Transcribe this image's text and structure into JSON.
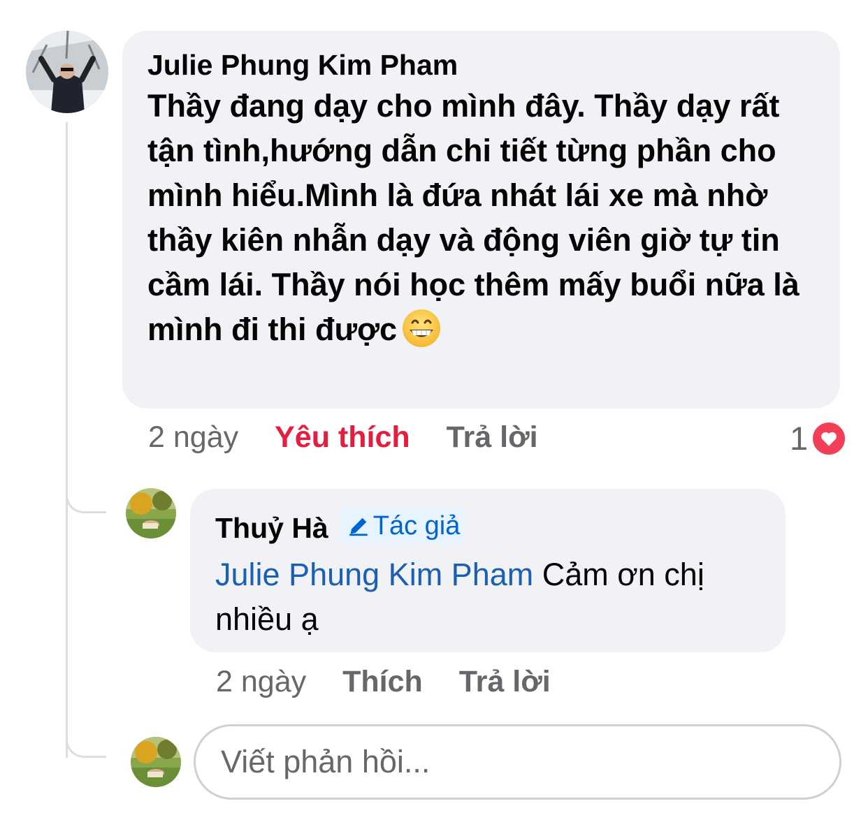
{
  "comment": {
    "author": "Julie Phung Kim Pham",
    "text": "Thầy đang dạy cho mình đây. Thầy dạy rất tận tình,hướng dẫn chi tiết từng phần cho mình hiểu.Mình là đứa nhát lái xe mà nhờ thầy kiên nhẫn dạy và động viên giờ tự tin cầm lái. Thầy nói học thêm mấy buổi nữa là mình đi thi được",
    "emoji": "grinning-face-emoji",
    "time": "2 ngày",
    "like_label": "Yêu thích",
    "reply_label": "Trả lời",
    "reaction_count": "1",
    "reaction_icon": "heart-icon",
    "like_color": "#e41e3f"
  },
  "reply": {
    "author": "Thuỷ Hà",
    "badge": "Tác giả",
    "badge_icon": "pencil-icon",
    "mention": "Julie Phung Kim Pham",
    "text": "Cảm ơn chị nhiều ạ",
    "time": "2 ngày",
    "like_label": "Thích",
    "reply_label": "Trả lời",
    "mention_color": "#1b5fb2"
  },
  "composer": {
    "placeholder": "Viết phản hồi..."
  }
}
